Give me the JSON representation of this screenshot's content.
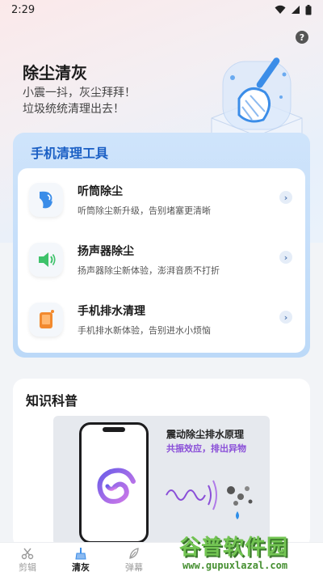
{
  "status_bar": {
    "time": "2:29"
  },
  "header": {
    "title": "除尘清灰",
    "subtitle_line1": "小震一抖，灰尘拜拜！",
    "subtitle_line2": "垃圾统统清理出去！",
    "help_label": "?"
  },
  "tools": {
    "title": "手机清理工具",
    "items": [
      {
        "name": "听筒除尘",
        "desc": "听筒除尘新升级，告别堵塞更清晰",
        "icon": "earpiece-icon"
      },
      {
        "name": "扬声器除尘",
        "desc": "扬声器除尘新体验，澎湃音质不打折",
        "icon": "speaker-icon"
      },
      {
        "name": "手机排水清理",
        "desc": "手机排水新体验，告别进水小烦恼",
        "icon": "water-drain-icon"
      }
    ]
  },
  "knowledge": {
    "title": "知识科普",
    "principle_title": "震动除尘排水原理",
    "principle_sub": "共振效应，排出异物"
  },
  "tab_bar": {
    "items": [
      {
        "label": "剪辑",
        "icon": "scissors-icon"
      },
      {
        "label": "清灰",
        "icon": "broom-icon"
      },
      {
        "label": "弹幕",
        "icon": "feather-icon"
      }
    ],
    "active_index": 1
  },
  "watermark": {
    "name": "谷普软件园",
    "url": "www.gupuxlazal.com"
  },
  "colors": {
    "accent": "#1a5fc4",
    "tools_card_bg": "#cfe4fb",
    "purple": "#8a4fd8"
  }
}
